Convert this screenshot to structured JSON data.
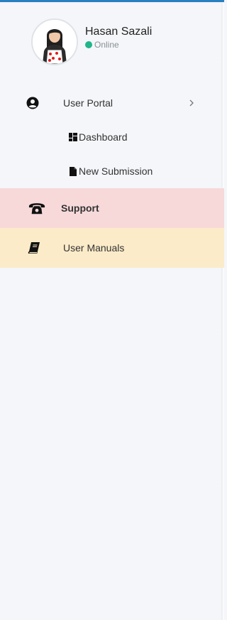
{
  "user": {
    "name": "Hasan Sazali",
    "status": "Online",
    "status_color": "#20b58a"
  },
  "menu": {
    "user_portal": {
      "label": "User Portal",
      "icon": "user-circle-icon",
      "expand_icon": "chevron-right-icon"
    },
    "dashboard": {
      "label": "Dashboard",
      "icon": "dashboard-grid-icon"
    },
    "new_submission": {
      "label": "New Submission",
      "icon": "file-icon"
    },
    "support": {
      "label": "Support",
      "icon": "phone-icon",
      "background": "#f7d9da"
    },
    "user_manuals": {
      "label": "User Manuals",
      "icon": "book-icon",
      "background": "#fbebc9"
    }
  },
  "colors": {
    "accent_top_border": "#2a7fc0",
    "sidebar_bg": "#f4f6f9"
  }
}
